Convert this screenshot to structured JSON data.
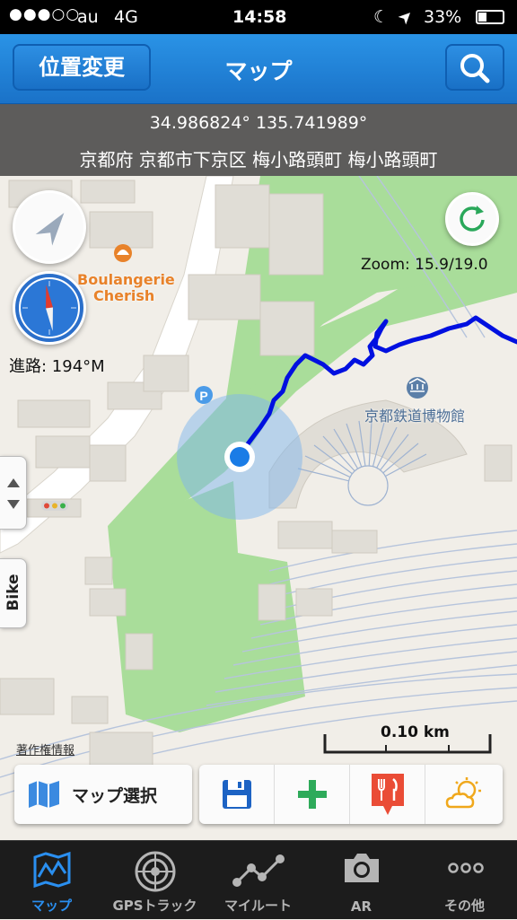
{
  "status_bar": {
    "signal": "●●●○○",
    "carrier": "au",
    "network": "4G",
    "time": "14:58",
    "moon": "☾",
    "location_arrow": "➤",
    "battery_percent": "33%",
    "battery_level": 0.33
  },
  "navbar": {
    "location_button_label": "位置変更",
    "title": "マップ",
    "search_icon": "search-icon"
  },
  "info": {
    "coordinates": "34.986824° 135.741989°",
    "address": "京都府 京都市下京区 梅小路頭町 梅小路頭町"
  },
  "map": {
    "zoom_text": "Zoom: 15.9/19.0",
    "heading_text": "進路: 194°M",
    "poi_bakery_line1": "Boulangerie",
    "poi_bakery_line2": "Cherish",
    "poi_museum": "京都鉄道博物館",
    "parking_label": "P",
    "copyright_link": "著作権情報",
    "scale_label": "0.10 km",
    "bike_tab_label": "Bike",
    "colors": {
      "track": "#0010e0",
      "park": "#a9dd9a",
      "location_dot": "#1a7ce6",
      "poi_orange": "#e8822a",
      "poi_blue": "#5b7fa8"
    }
  },
  "toolbar": {
    "map_select_label": "マップ選択",
    "save_icon": "floppy-disk-icon",
    "add_icon": "plus-icon",
    "restaurant_icon": "fork-knife-icon",
    "weather_icon": "sun-cloud-icon"
  },
  "tabs": [
    {
      "label": "マップ",
      "icon": "map-icon",
      "active": true
    },
    {
      "label": "GPSトラック",
      "icon": "radar-icon",
      "active": false
    },
    {
      "label": "マイルート",
      "icon": "route-icon",
      "active": false
    },
    {
      "label": "AR",
      "icon": "camera-icon",
      "active": false
    },
    {
      "label": "その他",
      "icon": "more-icon",
      "active": false
    }
  ],
  "colors": {
    "accent": "#2a93e6",
    "tab_active": "#2a8ff0",
    "tab_inactive": "#b5b5b5"
  }
}
